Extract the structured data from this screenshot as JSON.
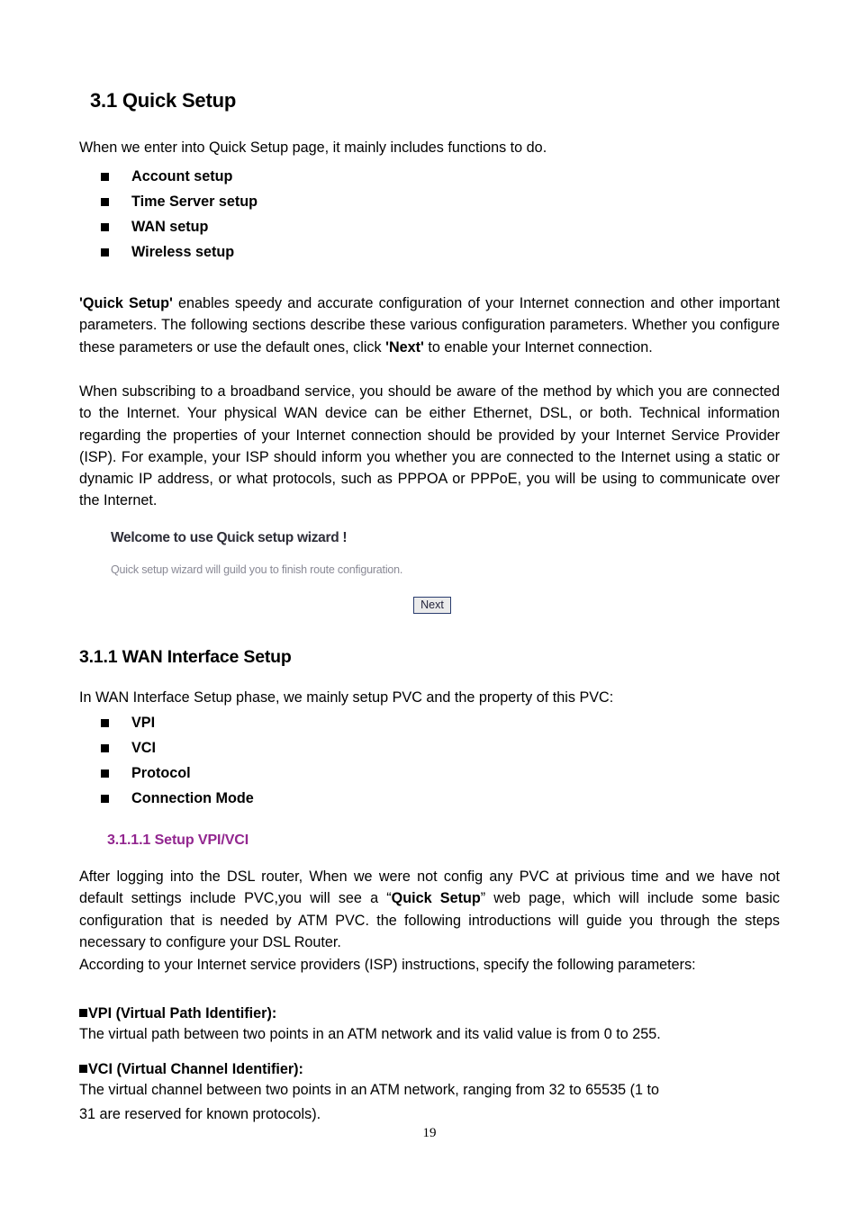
{
  "document": {
    "page_number": "19"
  },
  "section_31": {
    "heading": "3.1 Quick Setup",
    "intro": "When we enter into Quick Setup page, it mainly includes functions to do.",
    "bullets": [
      {
        "label": "Account setup"
      },
      {
        "label": "Time Server setup"
      },
      {
        "label": "WAN setup"
      },
      {
        "label": "Wireless setup"
      }
    ],
    "paragraph1": {
      "part1_bold": "'Quick Setup'",
      "part2": " enables speedy and accurate configuration of your Internet connection and other important parameters. The following sections describe these various configuration parameters. Whether you configure these parameters or use the default ones, click ",
      "part3_bold": "'Next'",
      "part4": " to enable your Internet connection."
    },
    "paragraph2": "When subscribing to a broadband service, you should be aware of the method by which you are connected to the Internet. Your physical WAN device can be either Ethernet, DSL, or both. Technical information regarding the properties of your Internet connection should be provided by your Internet Service Provider (ISP). For example, your ISP should inform you whether you are connected to the Internet using a static or dynamic IP address, or what protocols, such as PPPOA or PPPoE, you will be using to communicate over the Internet."
  },
  "screenshot": {
    "title": "Welcome to use Quick setup wizard !",
    "subtitle": "Quick setup wizard will guild you to finish route configuration.",
    "next_button": "Next"
  },
  "section_311": {
    "heading": "3.1.1 WAN Interface Setup",
    "intro": "In WAN Interface Setup phase, we mainly setup PVC and the property of this PVC:",
    "bullets": [
      {
        "label": "VPI"
      },
      {
        "label": "VCI"
      },
      {
        "label": "Protocol"
      },
      {
        "label": "Connection Mode"
      }
    ]
  },
  "section_3111": {
    "heading": "3.1.1.1 Setup VPI/VCI",
    "heading_color": "#92268F",
    "paragraph1": {
      "part1": "After logging into the DSL router, When we were not config any PVC at privious time and we have not default settings include PVC,you will see a “",
      "part2_bold": "Quick Setup",
      "part3": "” web page, which will include some basic configuration that is needed by ATM PVC. the following introductions will guide you through the steps necessary to configure your DSL Router."
    },
    "paragraph2": "According to your Internet service providers (ISP) instructions, specify the following parameters:",
    "vpi_heading": "VPI (Virtual Path Identifier):",
    "vpi_text": "The virtual path between two points in an ATM network and its valid value is from 0 to 255.",
    "vci_heading": "VCI (Virtual Channel Identifier):",
    "vci_text_line1": "The virtual channel between two points in an ATM network, ranging from 32 to 65535 (1 to",
    "vci_text_line2": "31 are reserved for known protocols)."
  }
}
